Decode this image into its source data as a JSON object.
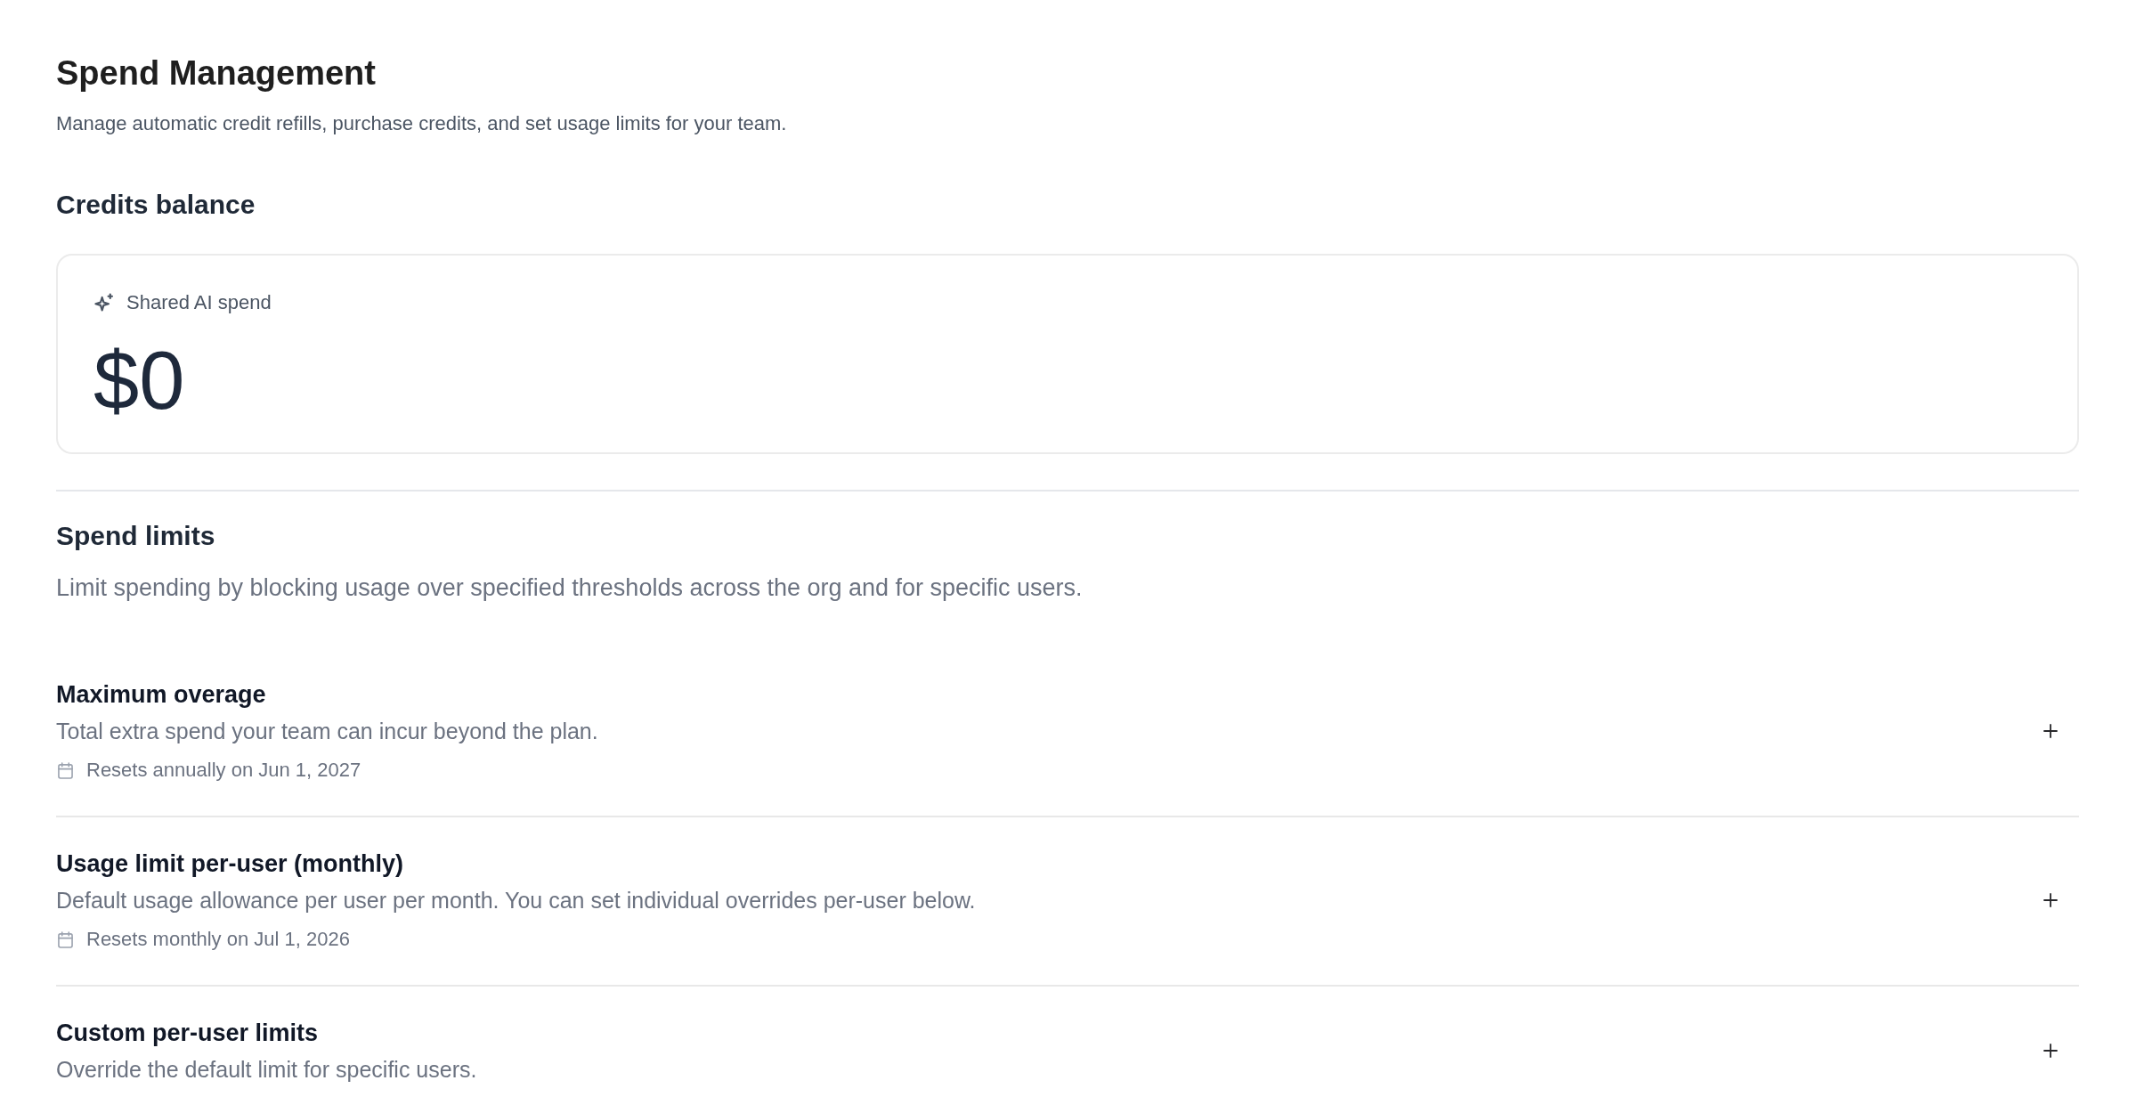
{
  "page": {
    "title": "Spend Management",
    "subtitle": "Manage automatic credit refills, purchase credits, and set usage limits for your team."
  },
  "credits_balance": {
    "heading": "Credits balance",
    "card": {
      "label": "Shared AI spend",
      "amount": "$0"
    }
  },
  "spend_limits": {
    "heading": "Spend limits",
    "description": "Limit spending by blocking usage over specified thresholds across the org and for specific users.",
    "items": [
      {
        "title": "Maximum overage",
        "description": "Total extra spend your team can incur beyond the plan.",
        "reset": "Resets annually on Jun 1, 2027"
      },
      {
        "title": "Usage limit per-user (monthly)",
        "description": "Default usage allowance per user per month. You can set individual overrides per-user below.",
        "reset": "Resets monthly on Jul 1, 2026"
      },
      {
        "title": "Custom per-user limits",
        "description": "Override the default limit for specific users."
      }
    ]
  }
}
